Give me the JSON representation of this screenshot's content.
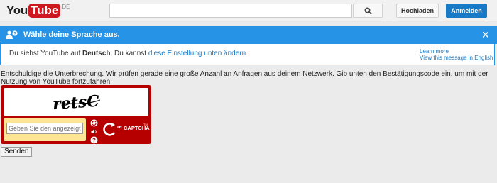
{
  "header": {
    "logo_you": "You",
    "logo_tube": "Tube",
    "logo_region": "DE",
    "search_value": "",
    "upload_label": "Hochladen",
    "signin_label": "Anmelden"
  },
  "language_banner": {
    "title": "Wähle deine Sprache aus.",
    "message_prefix": "Du siehst YouTube auf",
    "message_language": "Deutsch",
    "message_middle": ". Du kannst",
    "message_link": "diese Einstellung unten ändern",
    "message_suffix": ".",
    "learn_more": "Learn more",
    "view_english": "View this message in English"
  },
  "notice": "Entschuldige die Unterbrechung. Wir prüfen gerade eine große Anzahl an Anfragen aus deinem Netzwerk. Gib unten den Bestätigungscode ein, um mit der Nutzung von YouTube fortzufahren.",
  "captcha": {
    "challenge_text": "retsC",
    "input_placeholder": "Geben Sie den angezeigten Text ein",
    "brand_re": "re",
    "brand_captcha": "CAPTCHA",
    "brand_tm": "TM",
    "icons": [
      "refresh-icon",
      "audio-icon",
      "help-icon"
    ],
    "accent_color": "#b60000"
  },
  "submit_label": "Senden",
  "colors": {
    "banner_blue": "#2793e6",
    "link_blue": "#167ac6",
    "youtube_red": "#cc181e"
  }
}
